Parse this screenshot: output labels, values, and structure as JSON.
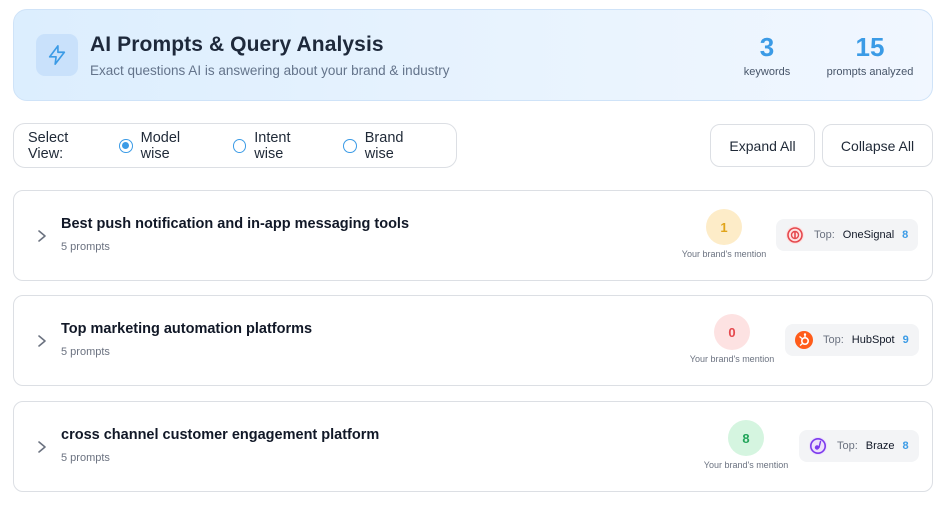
{
  "header": {
    "title": "AI Prompts & Query Analysis",
    "subtitle": "Exact questions AI is answering about your brand & industry",
    "icon": "lightning-icon",
    "stats": [
      {
        "value": "3",
        "label": "keywords"
      },
      {
        "value": "15",
        "label": "prompts analyzed"
      }
    ]
  },
  "view": {
    "label": "Select View:",
    "options": [
      "Model wise",
      "Intent wise",
      "Brand wise"
    ],
    "selected": "Model wise"
  },
  "actions": {
    "expand_label": "Expand All",
    "collapse_label": "Collapse All"
  },
  "colors": {
    "accent": "#3b9be6",
    "mention_yellow": "#fdecc8",
    "mention_red": "#fde2e2",
    "mention_green": "#d5f5e0"
  },
  "keywords": [
    {
      "title": "Best push notification and in-app messaging tools",
      "prompts": "5 prompts",
      "mention": "1",
      "mention_label": "Your brand's mention",
      "top_label": "Top:",
      "top_brand": "OneSignal",
      "top_count": "8",
      "logo_icon": "onesignal-logo-icon"
    },
    {
      "title": "Top marketing automation platforms",
      "prompts": "5 prompts",
      "mention": "0",
      "mention_label": "Your brand's mention",
      "top_label": "Top:",
      "top_brand": "HubSpot",
      "top_count": "9",
      "logo_icon": "hubspot-logo-icon"
    },
    {
      "title": "cross channel customer engagement platform",
      "prompts": "5 prompts",
      "mention": "8",
      "mention_label": "Your brand's mention",
      "top_label": "Top:",
      "top_brand": "Braze",
      "top_count": "8",
      "logo_icon": "braze-logo-icon"
    }
  ]
}
